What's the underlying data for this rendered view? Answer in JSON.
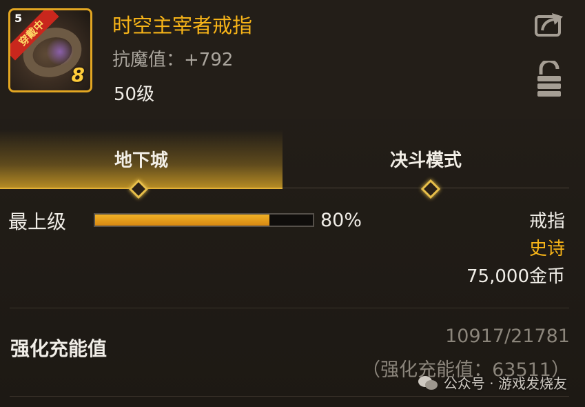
{
  "item": {
    "icon_level": "5",
    "equip_status": "穿戴中",
    "plus_level": "8",
    "name": "时空主宰者戒指",
    "stat": "抗魔值：+792",
    "level": "50级"
  },
  "header_icons": {
    "share": "share-icon",
    "lock": "lock-icon"
  },
  "tabs": [
    {
      "label": "地下城",
      "active": true
    },
    {
      "label": "决斗模式",
      "active": false
    }
  ],
  "rank": {
    "label": "最上级",
    "progress_text": "80%",
    "progress_fraction": 0.8
  },
  "details": {
    "type": "戒指",
    "grade": "史诗",
    "price": "75,000金币"
  },
  "charge": {
    "label": "强化充能值",
    "ratio": "10917/21781",
    "total": "（强化充能值：63511）"
  },
  "watermark": {
    "text": "公众号 · 游戏发烧友"
  },
  "colors": {
    "accent": "#f7b418",
    "bar": "#e8a21c",
    "frame": "#e2a622"
  }
}
